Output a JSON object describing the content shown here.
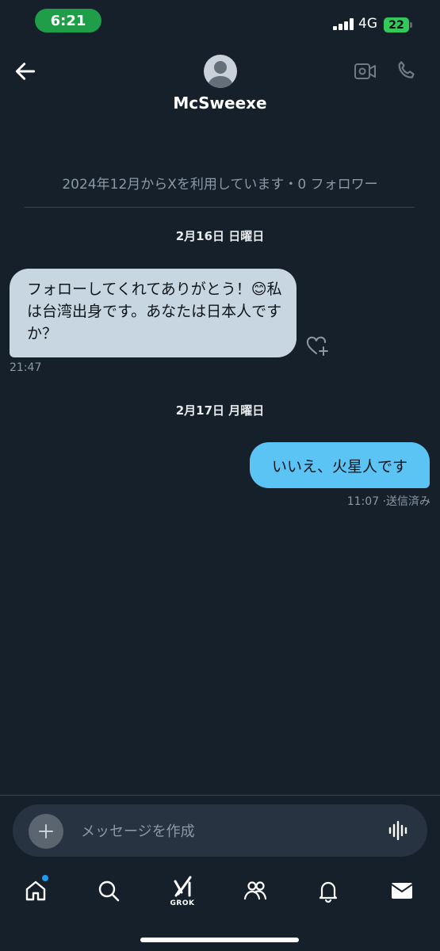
{
  "status_bar": {
    "time": "6:21",
    "network": "4G",
    "battery": "22"
  },
  "header": {
    "contact_name": "McSweexe",
    "back_icon": "back-arrow-icon",
    "video_icon": "video-call-icon",
    "phone_icon": "phone-call-icon"
  },
  "profile": {
    "join_info": "2024年12月からXを利用しています・0 フォロワー"
  },
  "messages": [
    {
      "date_separator": "2月16日 日曜日",
      "direction": "incoming",
      "text": "フォローしてくれてありがとう！😊私は台湾出身です。あなたは日本人ですか？",
      "time": "21:47"
    },
    {
      "date_separator": "2月17日 月曜日",
      "direction": "outgoing",
      "text": "いいえ、火星人です",
      "time": "11:07 ·送信済み"
    }
  ],
  "composer": {
    "placeholder": "メッセージを作成"
  },
  "bottom_nav": {
    "items": [
      {
        "icon": "home-icon",
        "has_badge": true
      },
      {
        "icon": "search-icon"
      },
      {
        "icon": "grok-icon",
        "label": "GROK"
      },
      {
        "icon": "communities-icon"
      },
      {
        "icon": "notifications-icon"
      },
      {
        "icon": "messages-icon"
      }
    ]
  },
  "colors": {
    "background": "#15202b",
    "incoming_bubble": "#c7d6e0",
    "outgoing_bubble": "#5bc4f5",
    "time_pill": "#1f9d48",
    "battery": "#34c759",
    "accent": "#1d9bf0"
  }
}
